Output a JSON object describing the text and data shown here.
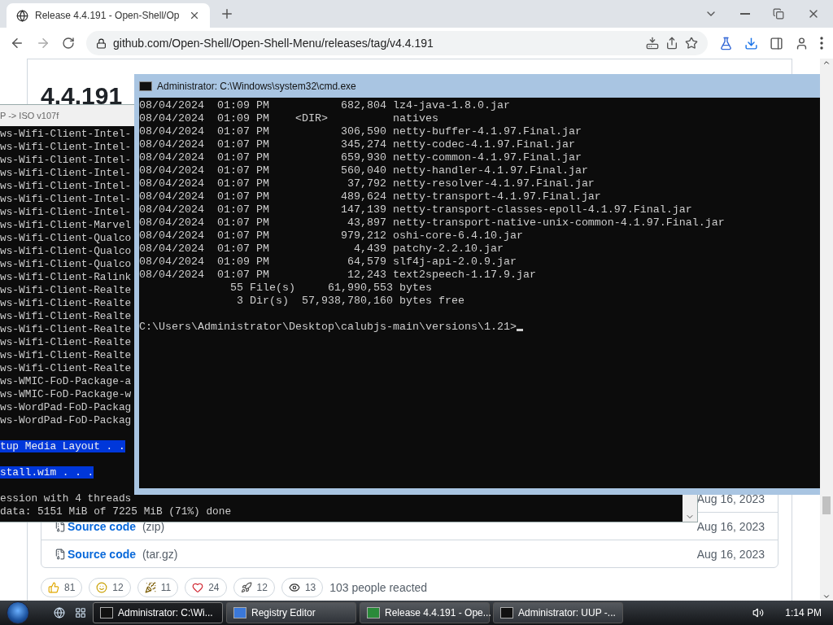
{
  "browser": {
    "tab": {
      "title": "Release 4.4.191 - Open-Shell/Op"
    },
    "url": "github.com/Open-Shell/Open-Shell-Menu/releases/tag/v4.4.191",
    "page": {
      "release_title": "4.4.191",
      "assets": [
        {
          "date": "Aug 16, 2023"
        },
        {
          "label": "Source code",
          "suffix": "(zip)",
          "date": "Aug 16, 2023"
        },
        {
          "label": "Source code",
          "suffix": "(tar.gz)",
          "date": "Aug 16, 2023"
        }
      ],
      "reactions": [
        {
          "kind": "thumbs-up",
          "count": "81"
        },
        {
          "kind": "laugh",
          "count": "12"
        },
        {
          "kind": "party",
          "count": "11"
        },
        {
          "kind": "heart",
          "count": "24"
        },
        {
          "kind": "rocket",
          "count": "12"
        },
        {
          "kind": "eyes",
          "count": "13"
        }
      ],
      "reacted_text": "103 people reacted"
    }
  },
  "back_console": {
    "title": "P -> ISO v107f",
    "lines": [
      {
        "kind": "text",
        "text": "ws-Wifi-Client-Intel-",
        "highlighted": false
      },
      {
        "kind": "text",
        "text": "ws-Wifi-Client-Intel-",
        "highlighted": false
      },
      {
        "kind": "text",
        "text": "ws-Wifi-Client-Intel-",
        "highlighted": false
      },
      {
        "kind": "text",
        "text": "ws-Wifi-Client-Intel-",
        "highlighted": false
      },
      {
        "kind": "text",
        "text": "ws-Wifi-Client-Intel-",
        "highlighted": false
      },
      {
        "kind": "text",
        "text": "ws-Wifi-Client-Intel-",
        "highlighted": false
      },
      {
        "kind": "text",
        "text": "ws-Wifi-Client-Intel-",
        "highlighted": false
      },
      {
        "kind": "text",
        "text": "ws-Wifi-Client-Marvel",
        "highlighted": false
      },
      {
        "kind": "text",
        "text": "ws-Wifi-Client-Qualco",
        "highlighted": false
      },
      {
        "kind": "text",
        "text": "ws-Wifi-Client-Qualco",
        "highlighted": false
      },
      {
        "kind": "text",
        "text": "ws-Wifi-Client-Qualco",
        "highlighted": false
      },
      {
        "kind": "text",
        "text": "ws-Wifi-Client-Ralink",
        "highlighted": false
      },
      {
        "kind": "text",
        "text": "ws-Wifi-Client-Realte",
        "highlighted": false
      },
      {
        "kind": "text",
        "text": "ws-Wifi-Client-Realte",
        "highlighted": false
      },
      {
        "kind": "text",
        "text": "ws-Wifi-Client-Realte",
        "highlighted": false
      },
      {
        "kind": "text",
        "text": "ws-Wifi-Client-Realte",
        "highlighted": false
      },
      {
        "kind": "text",
        "text": "ws-Wifi-Client-Realte",
        "highlighted": false
      },
      {
        "kind": "text",
        "text": "ws-Wifi-Client-Realte",
        "highlighted": false
      },
      {
        "kind": "text",
        "text": "ws-Wifi-Client-Realte",
        "highlighted": false
      },
      {
        "kind": "text",
        "text": "ws-WMIC-FoD-Package-a",
        "highlighted": false
      },
      {
        "kind": "text",
        "text": "ws-WMIC-FoD-Package-w",
        "highlighted": false
      },
      {
        "kind": "text",
        "text": "ws-WordPad-FoD-Packag",
        "highlighted": false
      },
      {
        "kind": "text",
        "text": "ws-WordPad-FoD-Packag",
        "highlighted": false
      },
      {
        "kind": "blank"
      },
      {
        "kind": "text",
        "text": "tup Media Layout . .",
        "highlighted": true
      },
      {
        "kind": "blank"
      },
      {
        "kind": "text",
        "text": "stall.wim . . .",
        "highlighted": true
      },
      {
        "kind": "blank"
      },
      {
        "kind": "text",
        "text": "ession with 4 threads",
        "highlighted": false
      },
      {
        "kind": "text",
        "text": "data: 5151 MiB of 7225 MiB (71%) done",
        "highlighted": false
      }
    ]
  },
  "cmd": {
    "title": "Administrator: C:\\Windows\\system32\\cmd.exe",
    "lines": [
      "08/04/2024  01:09 PM           682,804 lz4-java-1.8.0.jar",
      "08/04/2024  01:09 PM    <DIR>          natives",
      "08/04/2024  01:07 PM           306,590 netty-buffer-4.1.97.Final.jar",
      "08/04/2024  01:07 PM           345,274 netty-codec-4.1.97.Final.jar",
      "08/04/2024  01:07 PM           659,930 netty-common-4.1.97.Final.jar",
      "08/04/2024  01:07 PM           560,040 netty-handler-4.1.97.Final.jar",
      "08/04/2024  01:07 PM            37,792 netty-resolver-4.1.97.Final.jar",
      "08/04/2024  01:07 PM           489,624 netty-transport-4.1.97.Final.jar",
      "08/04/2024  01:07 PM           147,139 netty-transport-classes-epoll-4.1.97.Final.jar",
      "08/04/2024  01:07 PM            43,897 netty-transport-native-unix-common-4.1.97.Final.jar",
      "08/04/2024  01:07 PM           979,212 oshi-core-6.4.10.jar",
      "08/04/2024  01:07 PM             4,439 patchy-2.2.10.jar",
      "08/04/2024  01:09 PM            64,579 slf4j-api-2.0.9.jar",
      "08/04/2024  01:07 PM            12,243 text2speech-1.17.9.jar",
      "              55 File(s)     61,990,553 bytes",
      "               3 Dir(s)  57,938,780,160 bytes free"
    ],
    "prompt": "C:\\Users\\Administrator\\Desktop\\calubjs-main\\versions\\1.21>"
  },
  "taskbar": {
    "tasks": [
      {
        "kind": "cmd",
        "label": "Administrator: C:\\Wi...",
        "selected": true
      },
      {
        "kind": "registry",
        "label": "Registry Editor",
        "selected": false
      },
      {
        "kind": "browser",
        "label": "Release 4.4.191 - Ope...",
        "selected": false
      },
      {
        "kind": "cmd",
        "label": "Administrator:  UUP -...",
        "selected": false
      }
    ],
    "time": "1:14 PM"
  }
}
